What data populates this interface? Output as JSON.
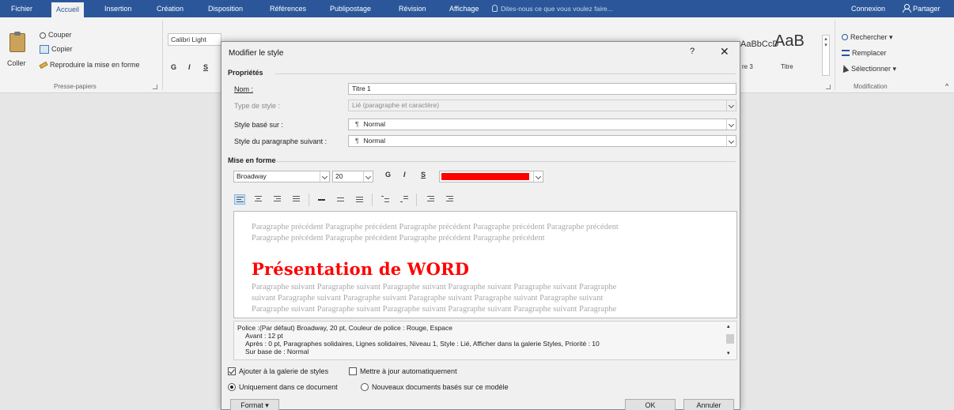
{
  "ribbon_tabs": [
    "Fichier",
    "Accueil",
    "Insertion",
    "Création",
    "Disposition",
    "Références",
    "Publipostage",
    "Révision",
    "Affichage"
  ],
  "tell_me": "Dites-nous ce que vous voulez faire...",
  "connexion": "Connexion",
  "partager": "Partager",
  "clipboard": {
    "paste": "Coller",
    "cut": "Couper",
    "copy": "Copier",
    "format_painter": "Reproduire la mise en forme",
    "group_label": "Presse-papiers"
  },
  "font": {
    "name": "Calibri Light",
    "bold": "G",
    "italic": "I",
    "underline": "S"
  },
  "styles": {
    "preview_1": "AaBbCcD",
    "preview_2": "AaB",
    "label_1": "re 3",
    "label_2": "Titre"
  },
  "editing": {
    "find": "Rechercher",
    "replace": "Remplacer",
    "select": "Sélectionner",
    "group_label": "Modification"
  },
  "dialog": {
    "title": "Modifier le style",
    "help": "?",
    "close": "✕",
    "properties_heading": "Propriétés",
    "name_label": "Nom :",
    "name_value": "Titre 1",
    "style_type_label": "Type de style :",
    "style_type_value": "Lié (paragraphe et caractère)",
    "based_on_label": "Style basé sur :",
    "based_on_value": "Normal",
    "next_style_label": "Style du paragraphe suivant :",
    "next_style_value": "Normal",
    "formatting_heading": "Mise en forme",
    "font_name": "Broadway",
    "font_size": "20",
    "bold": "G",
    "italic": "I",
    "underline": "S",
    "font_color": "#ff0000",
    "preview": {
      "previous_1": "Paragraphe précédent Paragraphe précédent Paragraphe précédent Paragraphe précédent Paragraphe précédent",
      "previous_2": "Paragraphe précédent Paragraphe précédent Paragraphe précédent Paragraphe précédent",
      "title": "Présentation de WORD",
      "next_1": "Paragraphe suivant Paragraphe suivant Paragraphe suivant Paragraphe suivant Paragraphe suivant Paragraphe",
      "next_2": "suivant Paragraphe suivant Paragraphe suivant Paragraphe suivant Paragraphe suivant Paragraphe suivant",
      "next_3": "Paragraphe suivant Paragraphe suivant Paragraphe suivant Paragraphe suivant Paragraphe suivant Paragraphe"
    },
    "description": {
      "line1": "Police :(Par défaut) Broadway, 20 pt, Couleur de police : Rouge, Espace",
      "line2": "Avant : 12 pt",
      "line3": "Après : 0 pt, Paragraphes solidaires, Lignes solidaires, Niveau 1, Style : Lié, Afficher dans la galerie Styles, Priorité : 10",
      "line4": "Sur base de : Normal"
    },
    "add_to_gallery": "Ajouter à la galerie de styles",
    "auto_update": "Mettre à jour automatiquement",
    "only_this_doc": "Uniquement dans ce document",
    "new_docs": "Nouveaux documents basés sur ce modèle",
    "format_button": "Format ▾",
    "ok_button": "OK",
    "cancel_button": "Annuler"
  }
}
